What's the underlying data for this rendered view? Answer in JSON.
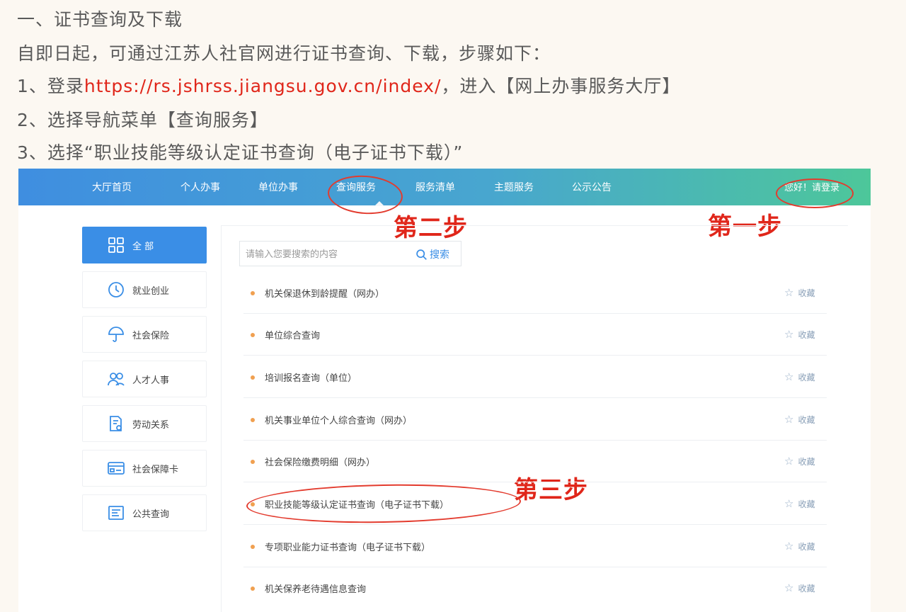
{
  "article": {
    "heading": "一、证书查询及下载",
    "intro": "自即日起，可通过江苏人社官网进行证书查询、下载，步骤如下：",
    "step1_prefix": "1、登录",
    "step1_url": "https://rs.jshrss.jiangsu.gov.cn/index/",
    "step1_suffix": "，进入【网上办事服务大厅】",
    "step2": "2、选择导航菜单【查询服务】",
    "step3": "3、选择“职业技能等级认定证书查询（电子证书下载）”"
  },
  "navbar": {
    "items": [
      "大厅首页",
      "个人办事",
      "单位办事",
      "查询服务",
      "服务清单",
      "主题服务",
      "公示公告"
    ],
    "login": "您好！请登录"
  },
  "annotations": {
    "step_one": "第一步",
    "step_two": "第二步",
    "step_three": "第三步"
  },
  "sidebar": {
    "items": [
      {
        "label": "全 部",
        "icon": "grid-icon"
      },
      {
        "label": "就业创业",
        "icon": "clock-icon"
      },
      {
        "label": "社会保险",
        "icon": "umbrella-icon"
      },
      {
        "label": "人才人事",
        "icon": "people-icon"
      },
      {
        "label": "劳动关系",
        "icon": "document-gear-icon"
      },
      {
        "label": "社会保障卡",
        "icon": "card-icon"
      },
      {
        "label": "公共查询",
        "icon": "form-icon"
      }
    ]
  },
  "search": {
    "placeholder": "请输入您要搜索的内容",
    "button_label": "搜索"
  },
  "list": {
    "favorite_label": "收藏",
    "items": [
      "机关保退休到龄提醒（网办）",
      "单位综合查询",
      "培训报名查询（单位）",
      "机关事业单位个人综合查询（网办）",
      "社会保险缴费明细（网办）",
      "职业技能等级认定证书查询（电子证书下载）",
      "专项职业能力证书查询（电子证书下载）",
      "机关保养老待遇信息查询"
    ]
  },
  "colors": {
    "annotation_red": "#e0261a",
    "nav_blue": "#3f8ee0",
    "nav_green": "#4dc79a",
    "active_blue": "#3a8ee6",
    "bullet_orange": "#f0a050"
  }
}
